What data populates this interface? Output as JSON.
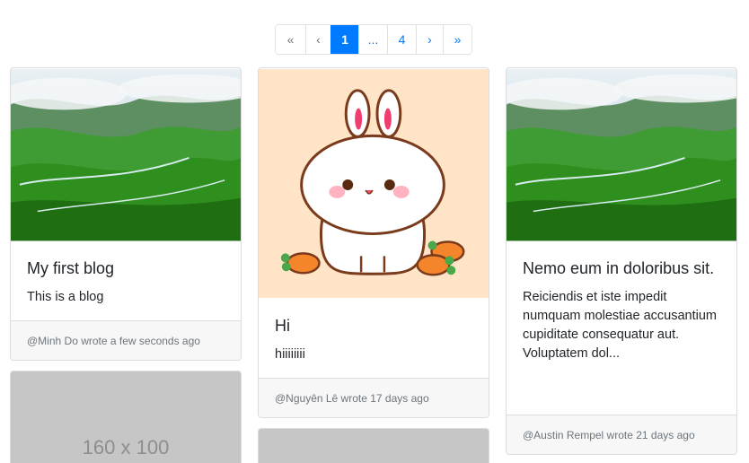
{
  "pagination": {
    "first": "«",
    "prev": "‹",
    "current": "1",
    "ellipsis": "...",
    "last_page": "4",
    "next": "›",
    "last": "»"
  },
  "cards": [
    {
      "title": "My first blog",
      "text": "This is a blog",
      "footer": "@Minh Do wrote a few seconds ago"
    },
    {
      "title": "Hi",
      "text": "hiiiiiiii",
      "footer": "@Nguyên Lê wrote 17 days ago"
    },
    {
      "title": "Nemo eum in doloribus sit.",
      "text": "Reiciendis et iste impedit numquam molestiae accusantium cupiditate consequatur aut. Voluptatem dol...",
      "footer": "@Austin Rempel wrote 21 days ago"
    }
  ],
  "placeholder": {
    "text": "160 x 100"
  },
  "colors": {
    "accent": "#007bff",
    "bunny_bg": "#ffe4c8",
    "placeholder_bg": "#c6c6c6"
  },
  "icons": [
    "mountain-landscape-image",
    "bunny-image"
  ]
}
